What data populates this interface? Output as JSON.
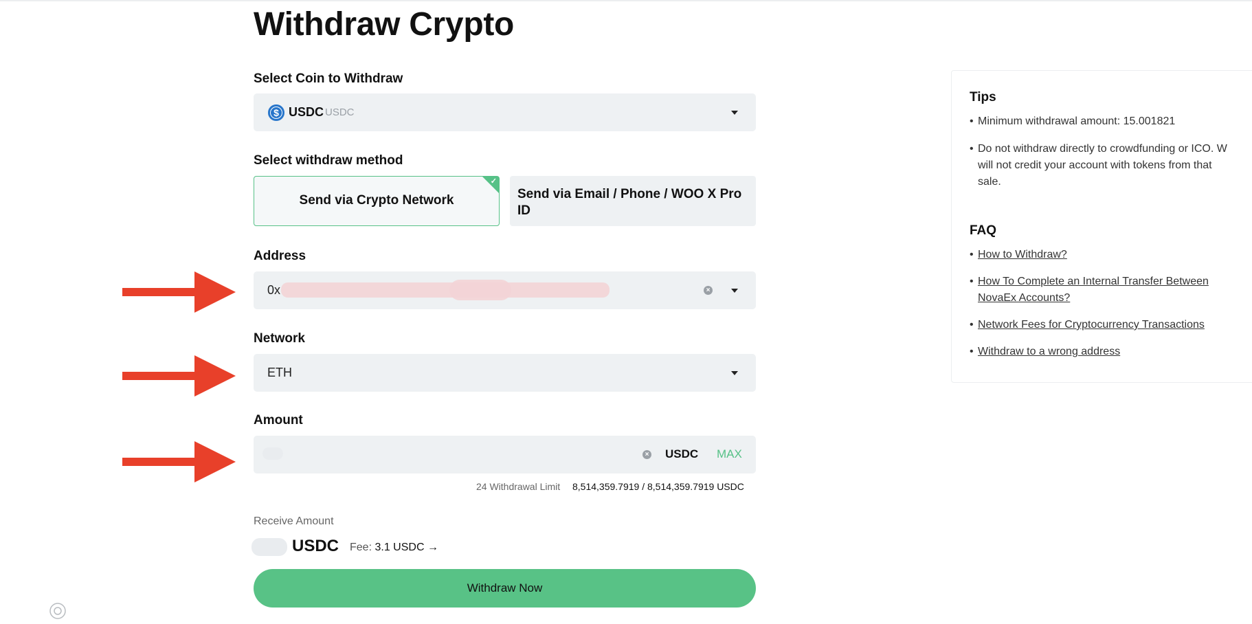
{
  "page": {
    "title": "Withdraw Crypto"
  },
  "coin": {
    "label": "Select Coin to Withdraw",
    "symbol": "USDC",
    "subtitle": "USDC",
    "icon": "usdc-coin-icon"
  },
  "method": {
    "label": "Select withdraw method",
    "option1": "Send via Crypto Network",
    "option2_line1": "Send via Email / Phone / WOO X Pro",
    "option2_line2": "ID",
    "selected": "Send via Crypto Network"
  },
  "address": {
    "label": "Address",
    "value": "0x"
  },
  "network": {
    "label": "Network",
    "value": "ETH"
  },
  "amount": {
    "label": "Amount",
    "currency": "USDC",
    "max_label": "MAX",
    "limit_label": "24 Withdrawal Limit",
    "limit_value": "8,514,359.7919 / 8,514,359.7919 USDC"
  },
  "receive": {
    "label": "Receive Amount",
    "currency": "USDC",
    "fee_label": "Fee:",
    "fee_value": "3.1 USDC",
    "fee_arrow": "→"
  },
  "withdraw_button": "Withdraw Now",
  "tips": {
    "title": "Tips",
    "items": [
      "Minimum withdrawal amount: 15.001821",
      "Do not withdraw directly to crowdfunding or ICO. W",
      "will not credit your account with tokens from that",
      "sale."
    ]
  },
  "faq": {
    "title": "FAQ",
    "links": [
      "How to Withdraw?",
      "How To Complete an Internal Transfer Between",
      "NovaEx Accounts?",
      "Network Fees for Cryptocurrency Transactions",
      "Withdraw to a wrong address"
    ]
  },
  "colors": {
    "accent_green": "#58c286",
    "arrow_red": "#e8402a",
    "field_bg": "#eef1f3",
    "usdc_blue": "#2775ca"
  }
}
